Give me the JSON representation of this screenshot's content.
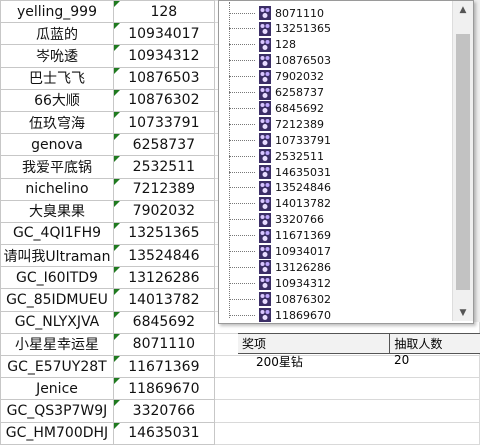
{
  "sheet": {
    "rows": [
      {
        "name": "yelling_999",
        "id": "128"
      },
      {
        "name": "瓜蓝的",
        "id": "10934017"
      },
      {
        "name": "岑吮逶",
        "id": "10934312"
      },
      {
        "name": "巴士飞飞",
        "id": "10876503"
      },
      {
        "name": "66大顺",
        "id": "10876302"
      },
      {
        "name": "伍玖穹海",
        "id": "10733791"
      },
      {
        "name": "genova",
        "id": "6258737"
      },
      {
        "name": "我爱平底锅",
        "id": "2532511"
      },
      {
        "name": "nichelino",
        "id": "7212389"
      },
      {
        "name": "大臭果果",
        "id": "7902032"
      },
      {
        "name": "GC_4QI1FH9",
        "id": "13251365"
      },
      {
        "name": "请叫我Ultraman",
        "id": "13524846"
      },
      {
        "name": "GC_I60ITD9",
        "id": "13126286"
      },
      {
        "name": "GC_85IDMUEU",
        "id": "14013782"
      },
      {
        "name": "GC_NLYXJVA",
        "id": "6845692"
      },
      {
        "name": "小星星幸运星",
        "id": "8071110"
      },
      {
        "name": "GC_E57UY28T",
        "id": "11671369"
      },
      {
        "name": "Jenice",
        "id": "11869670"
      },
      {
        "name": "GC_QS3P7W9J",
        "id": "3320766"
      },
      {
        "name": "GC_HM700DHJ",
        "id": "14635031"
      }
    ],
    "lower_table": {
      "header": [
        "奖项",
        "抽取人数"
      ],
      "row": [
        "200星钻",
        "20"
      ]
    }
  },
  "popup": {
    "items": [
      "8071110",
      "13251365",
      "128",
      "10876503",
      "7902032",
      "6258737",
      "6845692",
      "7212389",
      "10733791",
      "2532511",
      "14635031",
      "13524846",
      "14013782",
      "3320766",
      "11671369",
      "10934017",
      "13126286",
      "10934312",
      "10876302",
      "11869670"
    ]
  }
}
